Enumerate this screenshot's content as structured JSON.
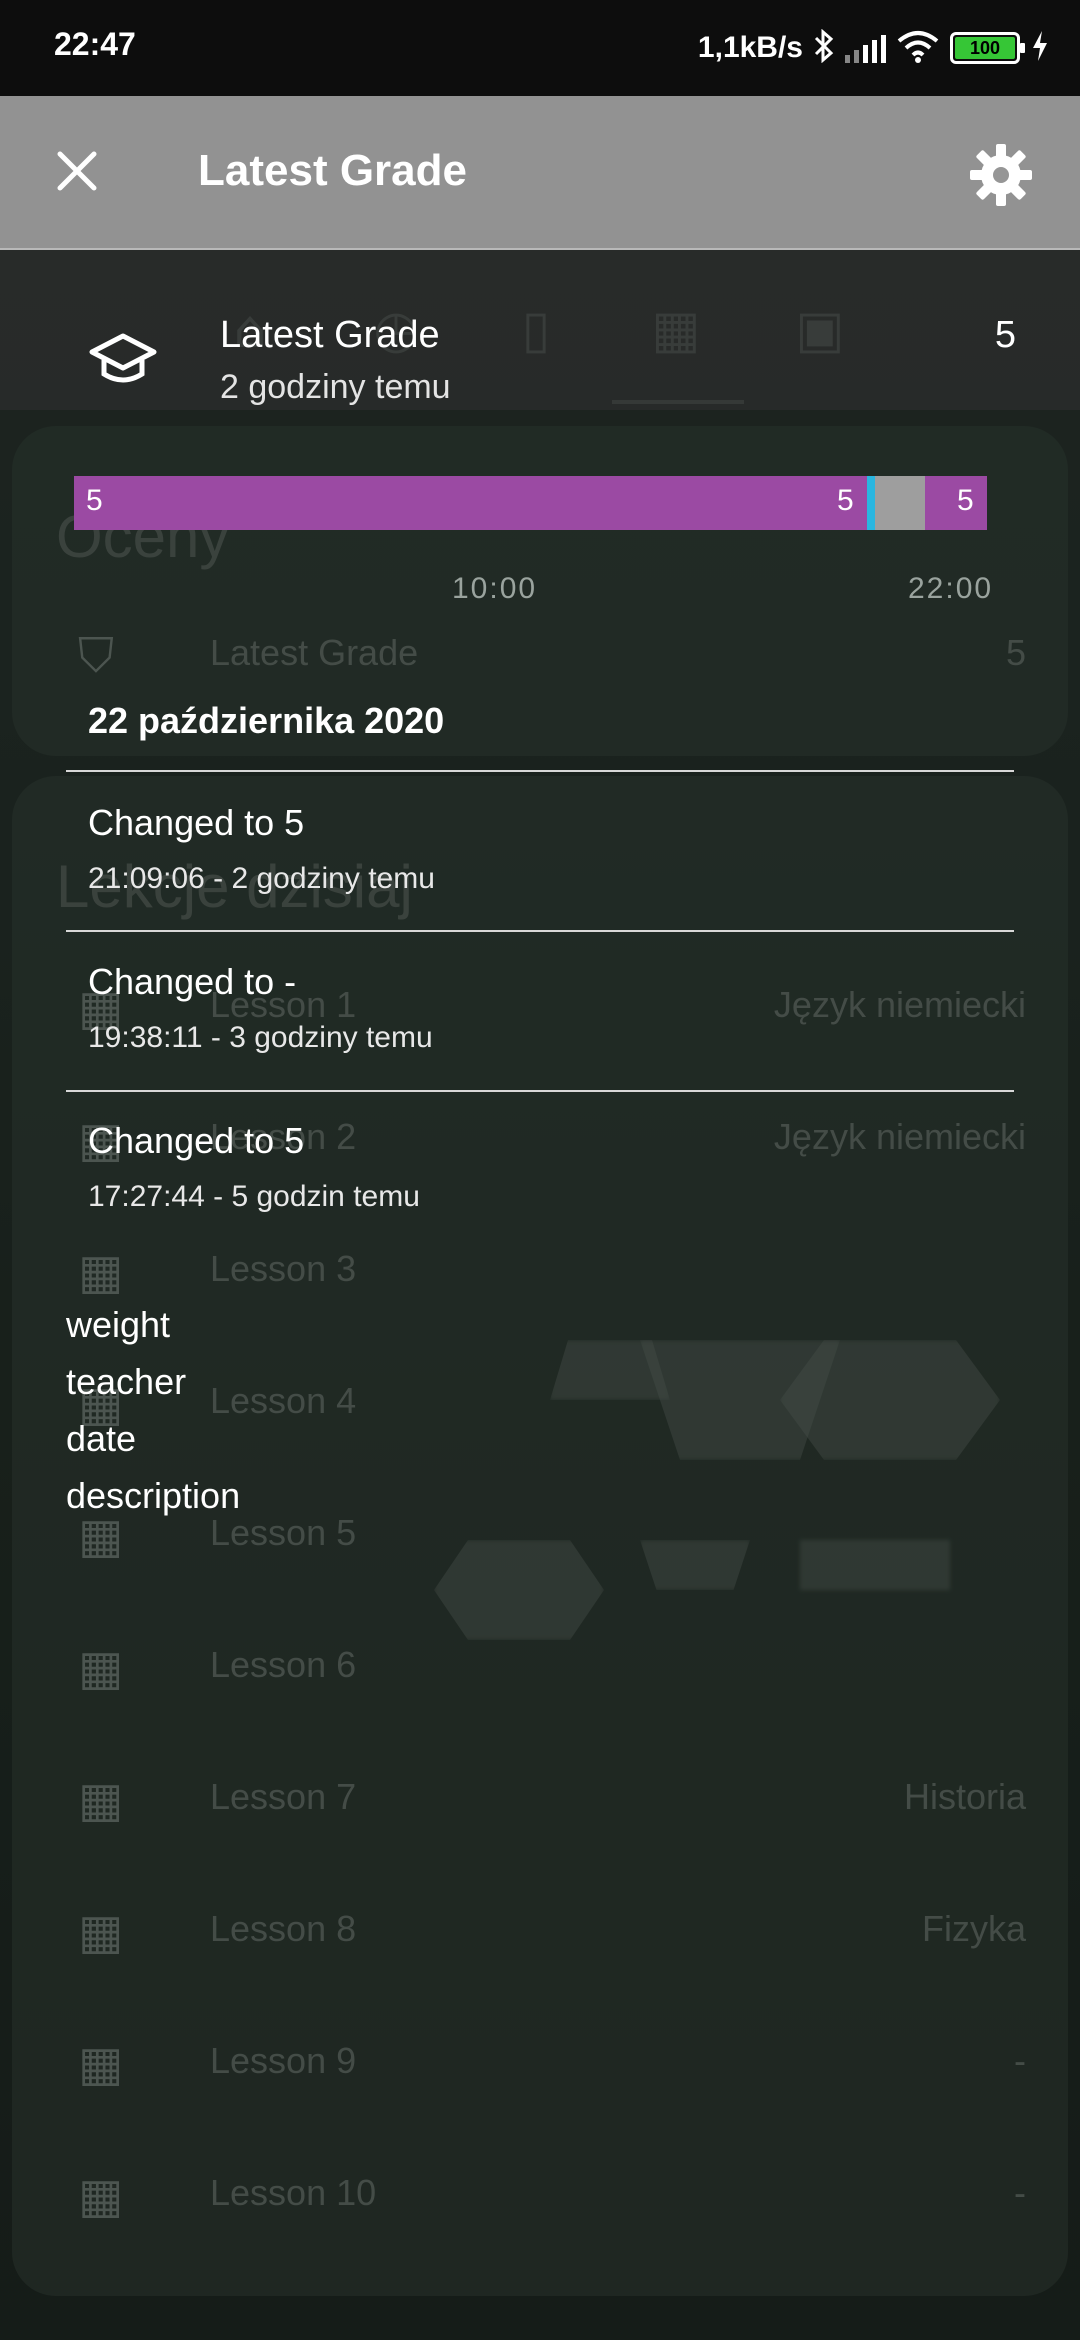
{
  "status_bar": {
    "time": "22:47",
    "net_speed": "1,1kB/s",
    "battery_level": "100",
    "icons": [
      "bluetooth-icon",
      "signal-icon",
      "wifi-icon",
      "battery-icon",
      "charging-icon"
    ]
  },
  "app_bar": {
    "title": "Latest Grade",
    "close_icon": "close-icon",
    "settings_icon": "gear-icon"
  },
  "grade": {
    "name": "Latest Grade",
    "relative_time": "2 godziny temu",
    "value": "5",
    "icon": "graduation-cap-icon"
  },
  "timeline": {
    "segments": [
      {
        "label": "5",
        "color": "#9b4aa3",
        "fraction": 0.778
      },
      {
        "label": "5",
        "color": "#9b4aa3",
        "fraction": 0.09
      },
      {
        "label": "",
        "color": "#29b6e0",
        "fraction": 0.009
      },
      {
        "label": "",
        "color": "#9e9e9e",
        "fraction": 0.055
      },
      {
        "label": "5",
        "color": "#9b4aa3",
        "fraction": 0.068
      }
    ],
    "time_labels": [
      "10:00",
      "22:00"
    ]
  },
  "date_heading": "22 października 2020",
  "history": [
    {
      "main": "Changed to 5",
      "meta": "21:09:06 - 2 godziny temu"
    },
    {
      "main": "Changed to -",
      "meta": "19:38:11 - 3 godziny temu"
    },
    {
      "main": "Changed to 5",
      "meta": "17:27:44 - 5 godzin temu"
    }
  ],
  "details": [
    "weight",
    "teacher",
    "date",
    "description"
  ],
  "background": {
    "section_grades": "Oceny",
    "grade_row": {
      "label": "Latest Grade",
      "value": "5"
    },
    "section_lessons": "Lekcje dzisiaj",
    "lessons": [
      {
        "label": "Lesson 1",
        "value": "Język niemiecki"
      },
      {
        "label": "Lesson 2",
        "value": "Język niemiecki"
      },
      {
        "label": "Lesson 3",
        "value": ""
      },
      {
        "label": "Lesson 4",
        "value": ""
      },
      {
        "label": "Lesson 5",
        "value": ""
      },
      {
        "label": "Lesson 6",
        "value": ""
      },
      {
        "label": "Lesson 7",
        "value": "Historia"
      },
      {
        "label": "Lesson 8",
        "value": "Fizyka"
      },
      {
        "label": "Lesson 9",
        "value": "-"
      },
      {
        "label": "Lesson 10",
        "value": "-"
      }
    ]
  }
}
